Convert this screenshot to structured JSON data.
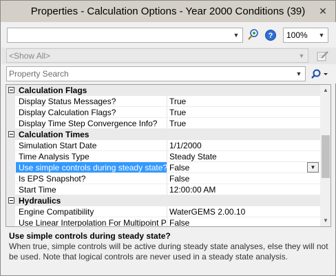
{
  "window": {
    "title": "Properties - Calculation Options - Year 2000 Conditions (39)",
    "close_icon": "close-x"
  },
  "toolbar": {
    "element_combo_value": "",
    "zoom_value": "100%",
    "icons": [
      "find-zoom-icon",
      "help-icon"
    ]
  },
  "filter": {
    "show_value": "<Show All>",
    "edit_icon": "pencil-edit-icon"
  },
  "search": {
    "placeholder": "Property Search",
    "find_icon": "magnifier-icon"
  },
  "grid": {
    "categories": [
      {
        "label": "Calculation Flags",
        "properties": [
          {
            "name": "Display Status Messages?",
            "value": "True"
          },
          {
            "name": "Display Calculation Flags?",
            "value": "True"
          },
          {
            "name": "Display Time Step Convergence Info?",
            "value": "True"
          }
        ]
      },
      {
        "label": "Calculation Times",
        "properties": [
          {
            "name": "Simulation Start Date",
            "value": "1/1/2000"
          },
          {
            "name": "Time Analysis Type",
            "value": "Steady State"
          },
          {
            "name": "Use simple controls during steady state?",
            "value": "False",
            "selected": true
          },
          {
            "name": "Is EPS Snapshot?",
            "value": "False"
          },
          {
            "name": "Start Time",
            "value": "12:00:00 AM"
          }
        ]
      },
      {
        "label": "Hydraulics",
        "properties": [
          {
            "name": "Engine Compatibility",
            "value": "WaterGEMS 2.00.10"
          },
          {
            "name": "Use Linear Interpolation For Multipoint Pumps?",
            "value": "False"
          }
        ]
      }
    ]
  },
  "help": {
    "title": "Use simple controls during steady state?",
    "text": "When true, simple controls will be active during steady state analyses, else they will not be used. Note that logical controls are never used in a steady state analysis."
  }
}
